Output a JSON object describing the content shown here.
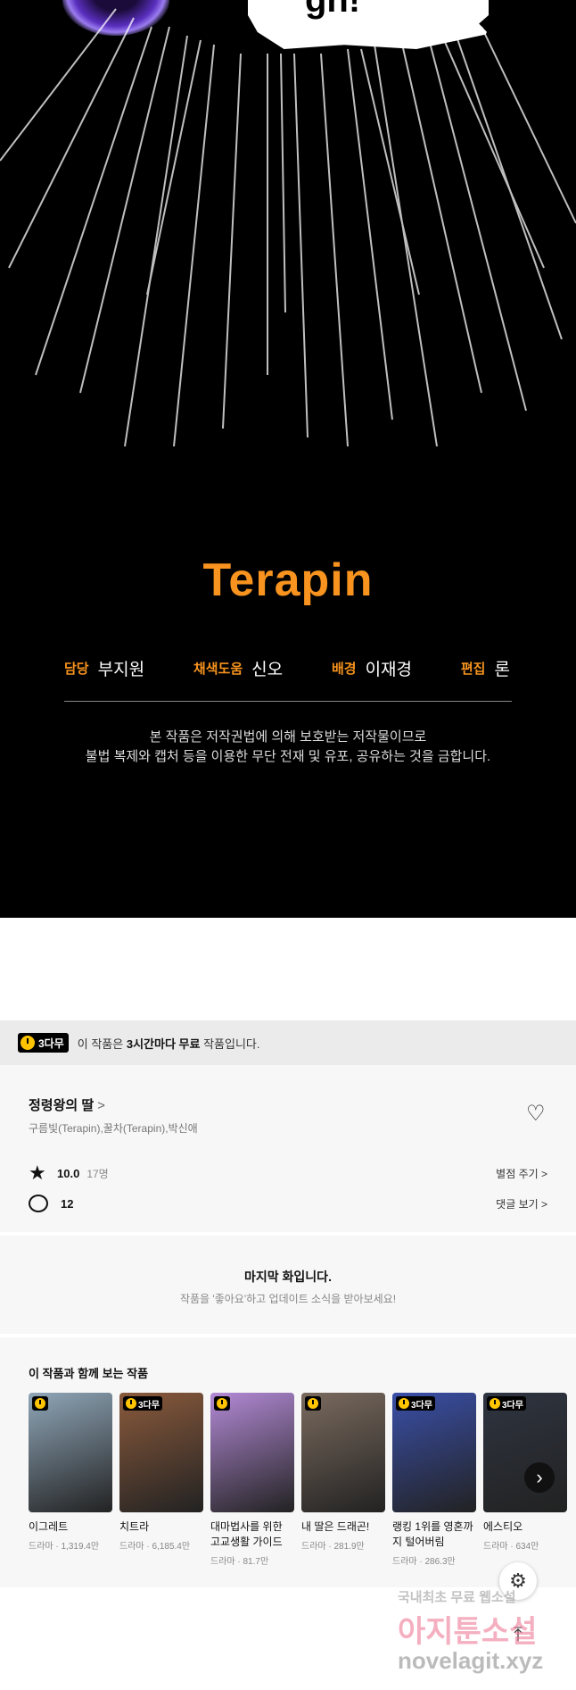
{
  "comic": {
    "bubble_text": "gh!",
    "logo": "Terapin"
  },
  "credits": [
    {
      "role": "담당",
      "name": "부지원"
    },
    {
      "role": "채색도움",
      "name": "신오"
    },
    {
      "role": "배경",
      "name": "이재경"
    },
    {
      "role": "편집",
      "name": "론"
    }
  ],
  "notice": {
    "line1": "본 작품은 저작권법에 의해 보호받는 저작물이므로",
    "line2": "불법 복제와 캡처 등을 이용한 무단 전재 및 유포, 공유하는 것을 금합니다."
  },
  "banner": {
    "badge": "3다무",
    "text_prefix": "이 작품은 ",
    "text_bold": "3시간마다 무료",
    "text_suffix": " 작품입니다."
  },
  "work": {
    "title": "정령왕의 딸",
    "title_chevron": ">",
    "authors": "구름빛(Terapin),꿀차(Terapin),박신애",
    "rating": "10.0",
    "rating_count": "17명",
    "rate_link": "별점 주기 >",
    "comment_count": "12",
    "comment_link": "댓글 보기 >"
  },
  "last_episode": {
    "title": "마지막 화입니다.",
    "subtitle": "작품을 '좋아요'하고 업데이트 소식을 받아보세요!"
  },
  "recommendations": {
    "heading": "이 작품과 함께 보는 작품",
    "items": [
      {
        "title": "이그레트",
        "meta": "드라마 · 1,319.4만",
        "badge": "",
        "color": "#8fa6b8"
      },
      {
        "title": "치트라",
        "meta": "드라마 · 6,185.4만",
        "badge": "3다무",
        "color": "#8a5a3c"
      },
      {
        "title": "대마법사를 위한 고교생활 가이드",
        "meta": "드라마 · 81.7만",
        "badge": "",
        "color": "#b38ad6"
      },
      {
        "title": "내 딸은 드래곤!",
        "meta": "드라마 · 281.9만",
        "badge": "",
        "color": "#7a6a5e"
      },
      {
        "title": "랭킹 1위를 영혼까지 털어버림",
        "meta": "드라마 · 286.3만",
        "badge": "3다무",
        "color": "#3a4fa8"
      },
      {
        "title": "에스티오",
        "meta": "드라마 · 634만",
        "badge": "3다무",
        "color": "#2e3440"
      }
    ]
  },
  "watermark": {
    "line1": "국내최초 무료 웹소설",
    "line2": "아지툰소설",
    "line3": "novelagit.xyz"
  }
}
